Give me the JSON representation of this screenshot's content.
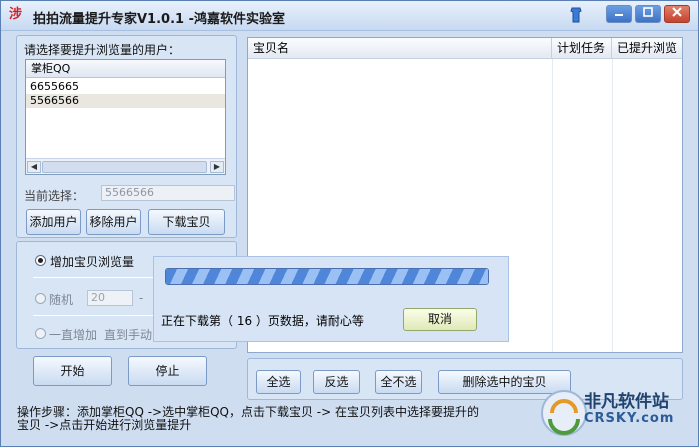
{
  "window": {
    "title": "拍拍流量提升专家V1.0.1  -鸿嘉软件实验室",
    "app_icon_glyph": "涉"
  },
  "users_panel": {
    "prompt": "请选择要提升浏览量的用户：",
    "list_header": "掌柜QQ",
    "users": [
      "6655665",
      "5566566"
    ],
    "current_label": "当前选择：",
    "current_value": "5566566",
    "add_button": "添加用户",
    "remove_button": "移除用户",
    "download_button": "下载宝贝"
  },
  "mode_panel": {
    "option_increase": "增加宝贝浏览量",
    "option_random": "随机",
    "random_value": "20",
    "random_dash": "-",
    "option_keep": "一直增加",
    "keep_suffix": "直到手动"
  },
  "controls": {
    "start_button": "开始",
    "stop_button": "停止"
  },
  "items_table": {
    "columns": [
      "宝贝名",
      "计划任务",
      "已提升浏览"
    ]
  },
  "bottom_bar": {
    "select_all": "全选",
    "invert": "反选",
    "select_none": "全不选",
    "delete_selected": "删除选中的宝贝"
  },
  "steps_text": {
    "line1": "操作步骤：添加掌柜QQ ->选中掌柜QQ，点击下载宝贝 -> 在宝贝列表中选择要提升的",
    "line2": "宝贝   ->点击开始进行浏览量提升"
  },
  "progress_dialog": {
    "message": "正在下载第（ 16 ）页数据，请耐心等",
    "cancel_button": "取消",
    "progress": 1.0
  },
  "watermark": {
    "name": "非凡软件站",
    "domain": "CRSKY.com"
  },
  "colors": {
    "window_bg": "#ceddf0",
    "accent": "#4f86d9"
  }
}
